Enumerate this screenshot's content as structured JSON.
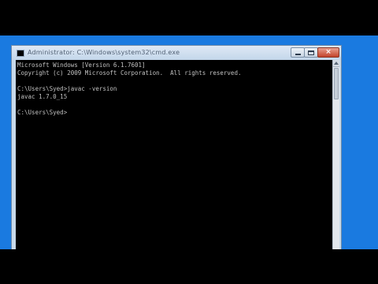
{
  "window": {
    "title": "Administrator: C:\\Windows\\system32\\cmd.exe",
    "controls": {
      "minimize": "minimize",
      "maximize": "maximize",
      "close": "×"
    }
  },
  "console": {
    "lines": [
      "Microsoft Windows [Version 6.1.7601]",
      "Copyright (c) 2009 Microsoft Corporation.  All rights reserved.",
      "",
      "C:\\Users\\Syed>javac -version",
      "javac 1.7.0_15",
      "",
      "C:\\Users\\Syed>"
    ],
    "text_color": "#c0c0c0",
    "background_color": "#000000"
  },
  "desktop": {
    "background_color": "#1a7ae0"
  }
}
